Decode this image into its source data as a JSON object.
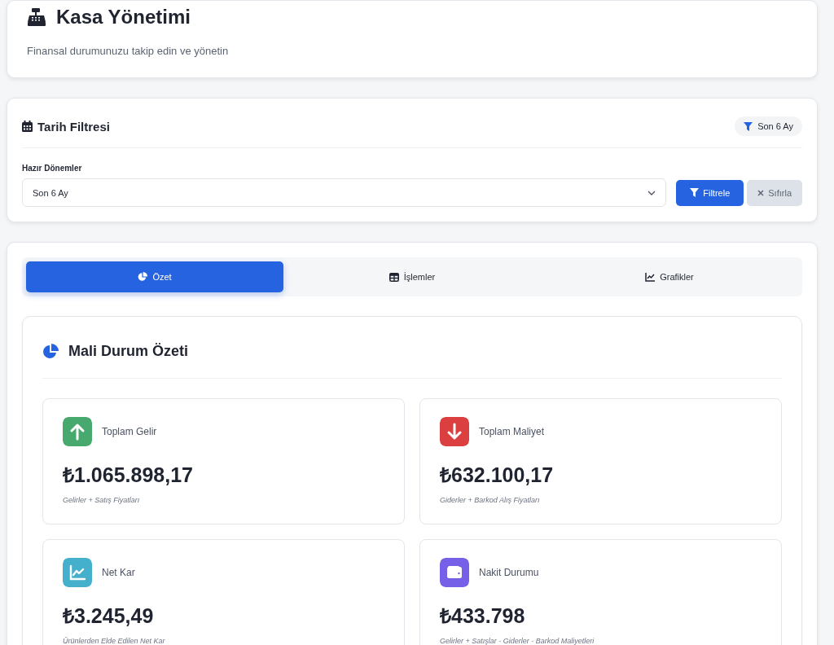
{
  "header": {
    "title": "Kasa Yönetimi",
    "subtitle": "Finansal durumunuzu takip edin ve yönetin"
  },
  "date_filter": {
    "title": "Tarih Filtresi",
    "active_badge": "Son 6 Ay",
    "preset_label": "Hazır Dönemler",
    "preset_value": "Son 6 Ay",
    "buttons": [
      {
        "label": "Filtrele",
        "kind": "primary"
      },
      {
        "label": "Sıfırla",
        "kind": "secondary"
      }
    ]
  },
  "tabs": [
    {
      "label": "Özet",
      "kind": "pie",
      "selected": true
    },
    {
      "label": "İşlemler",
      "kind": "table",
      "selected": false
    },
    {
      "label": "Grafikler",
      "kind": "chart",
      "selected": false
    }
  ],
  "summary": {
    "title": "Mali Durum Özeti",
    "cards": [
      {
        "label": "Toplam Gelir",
        "value": "₺1.065.898,17",
        "note": "Gelirler + Satış Fiyatları",
        "kind": "up",
        "color": "#48a96f"
      },
      {
        "label": "Toplam Maliyet",
        "value": "₺632.100,17",
        "note": "Giderler + Barkod Alış Fiyatları",
        "kind": "down",
        "color": "#dc3f3f"
      },
      {
        "label": "Net Kar",
        "value": "₺3.245,49",
        "note": "Ürünlerden Elde Edilen Net Kar",
        "kind": "chart",
        "color": "#45b0cc"
      },
      {
        "label": "Nakit Durumu",
        "value": "₺433.798",
        "note": "Gelirler + Satışlar - Giderler - Barkod Maliyetleri",
        "kind": "wallet",
        "color": "#7660e8"
      }
    ]
  }
}
